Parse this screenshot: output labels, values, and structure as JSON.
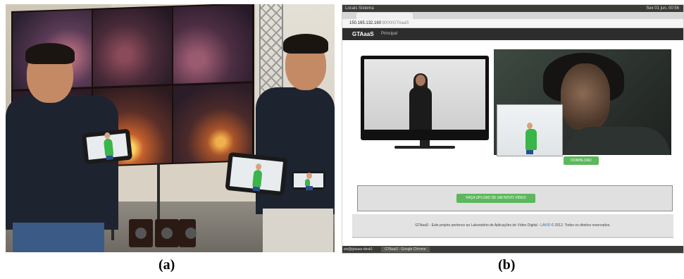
{
  "captions": {
    "a": "(a)",
    "b": "(b)"
  },
  "browser": {
    "os_bar_left": "Locais  Sistema",
    "os_bar_right": "Sex 01 jun, 00:56",
    "url": "150.165.132.160",
    "url_path": ":8000/GTAaaS",
    "site_brand": "GTAaaS",
    "nav_link": "Principal",
    "download_label": "DOWNLOAD",
    "upload_label": "FAÇA UPLOAD DE UM NOVO VÍDEO",
    "footer_text_1": "GTAaaS - Este projeto pertence ao Laboratório de Aplicações de Vídeo Digital - ",
    "footer_link": "LAVID",
    "footer_text_2": " © 2012. Todos os direitos reservados.",
    "taskbar_user": "ws@gtaaas-desk1",
    "taskbar_task": "GTAaaS - Google Chrome"
  },
  "colors": {
    "button_green": "#5cb85c",
    "navbar_dark": "#2d2d2d",
    "avatar_green": "#39b54a"
  }
}
